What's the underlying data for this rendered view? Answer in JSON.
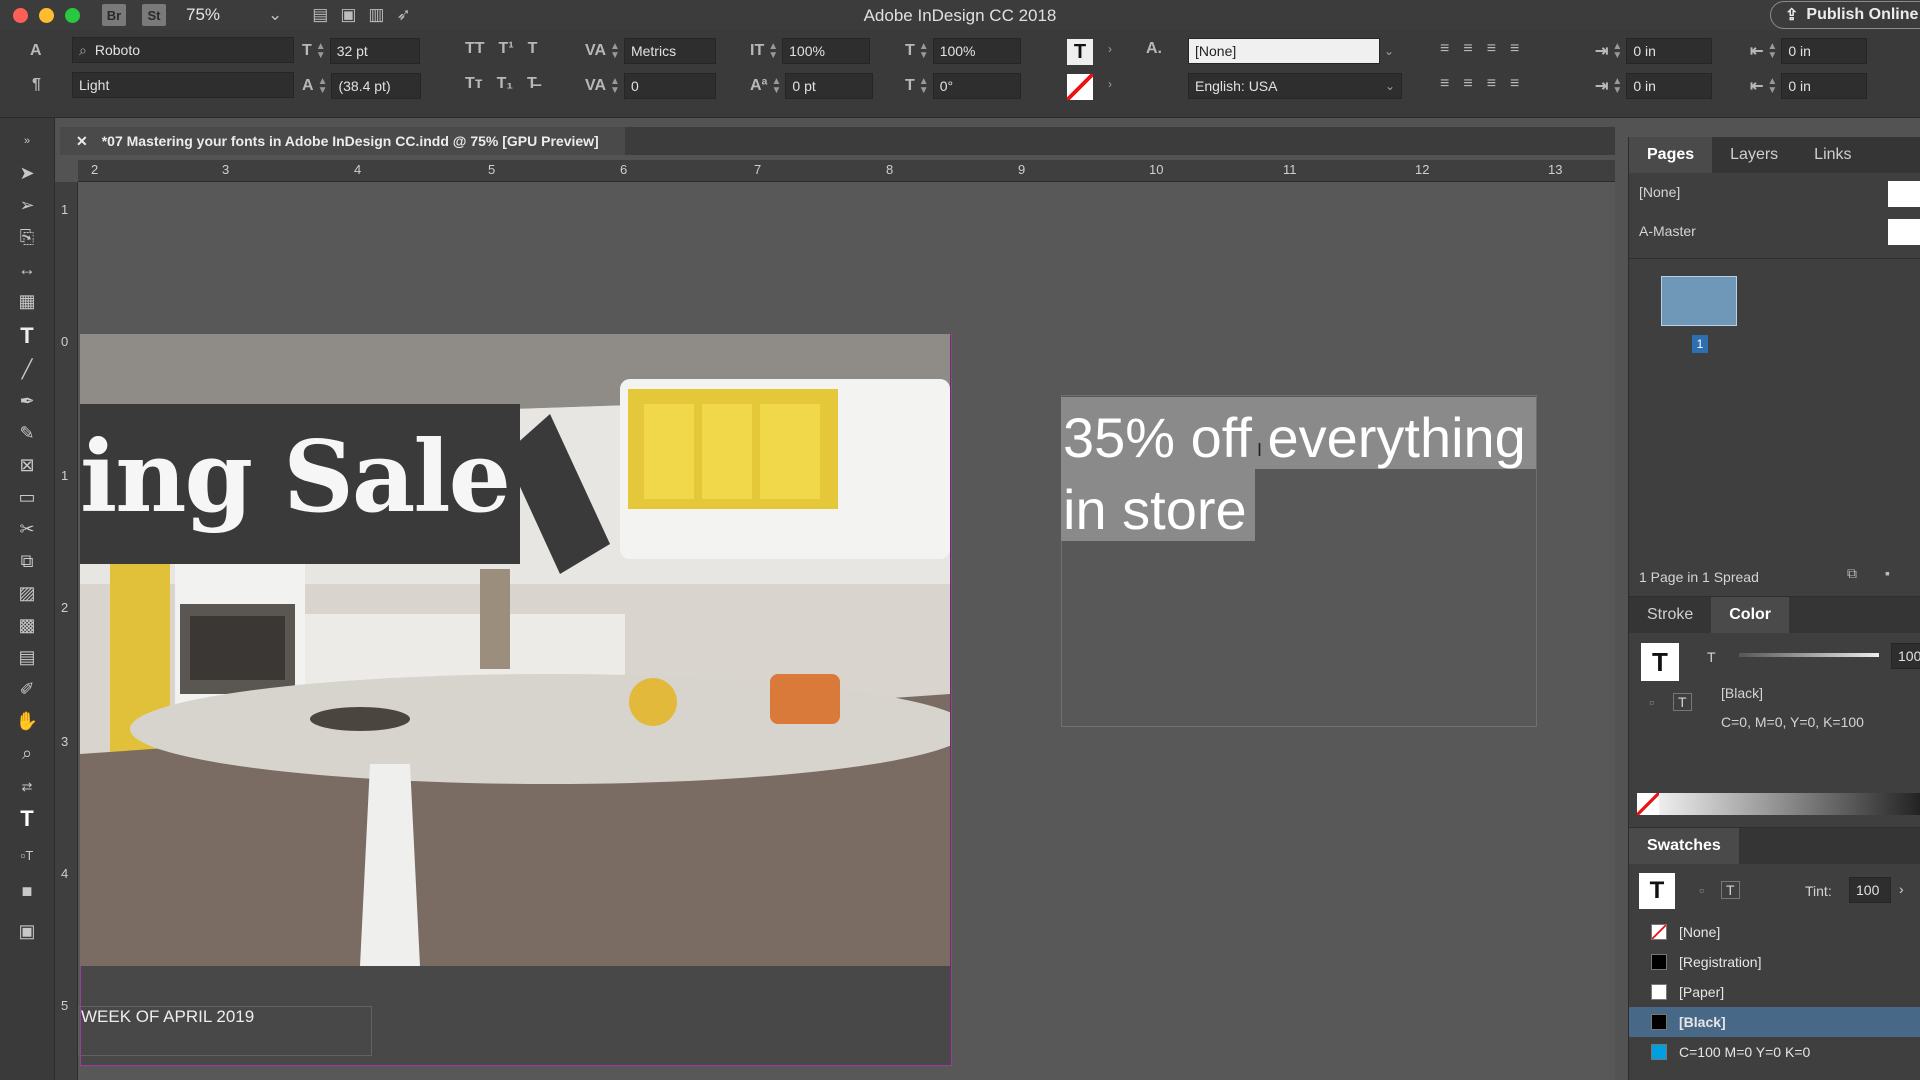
{
  "app": {
    "title": "Adobe InDesign CC 2018",
    "zoom": "75%",
    "badges": [
      "Br",
      "St"
    ],
    "publish_label": "Publish Online"
  },
  "control": {
    "font_family": "Roboto",
    "font_style": "Light",
    "font_size": "32 pt",
    "leading": "(38.4 pt)",
    "kerning": "Metrics",
    "tracking": "0",
    "vscale": "100%",
    "hscale": "100%",
    "baseline": "0 pt",
    "skew": "0°",
    "char_style": "[None]",
    "language": "English: USA",
    "indent_left": "0 in",
    "indent_first": "0 in",
    "indent_right": "0 in",
    "indent_last": "0 in"
  },
  "document": {
    "tab_label": "*07 Mastering your fonts in Adobe InDesign CC.indd @ 75% [GPU Preview]",
    "ruler_top": [
      "2",
      "3",
      "4",
      "5",
      "6",
      "7",
      "8",
      "9",
      "10",
      "11",
      "12",
      "13"
    ],
    "ruler_left": [
      "1",
      "0",
      "1",
      "2",
      "3",
      "4",
      "5"
    ],
    "banner_text": "ing Sale",
    "week_text": "WEEK OF APRIL 2019",
    "promo_line1": "35% off everything",
    "promo_line2": "in store"
  },
  "pages_panel": {
    "tabs": [
      "Pages",
      "Layers",
      "Links"
    ],
    "none_label": "[None]",
    "master_label": "A-Master",
    "page_number": "1",
    "status": "1 Page in 1 Spread"
  },
  "color_panel": {
    "tabs": [
      "Stroke",
      "Color"
    ],
    "tint_value": "100",
    "swatch_name": "[Black]",
    "swatch_values": "C=0, M=0, Y=0, K=100"
  },
  "swatches_panel": {
    "title": "Swatches",
    "tint_label": "Tint:",
    "tint_value": "100",
    "items": [
      {
        "name": "[None]",
        "color": "#ffffff"
      },
      {
        "name": "[Registration]",
        "color": "#000000"
      },
      {
        "name": "[Paper]",
        "color": "#ffffff"
      },
      {
        "name": "[Black]",
        "color": "#000000"
      },
      {
        "name": "C=100 M=0 Y=0 K=0",
        "color": "#00a0e0"
      }
    ]
  }
}
